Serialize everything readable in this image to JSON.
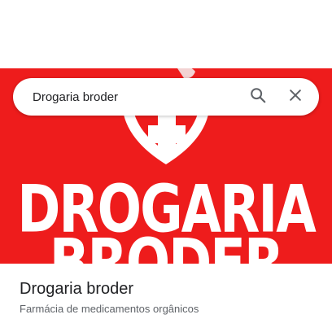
{
  "search": {
    "query": "Drogaria broder"
  },
  "hero": {
    "logo_lines": [
      "DROGARIA",
      "BRODER"
    ],
    "background_color": "#ee1c1c"
  },
  "place": {
    "name": "Drogaria broder",
    "category": "Farmácia de medicamentos orgânicos"
  },
  "icons": {
    "search": "search-icon",
    "close": "close-icon"
  }
}
